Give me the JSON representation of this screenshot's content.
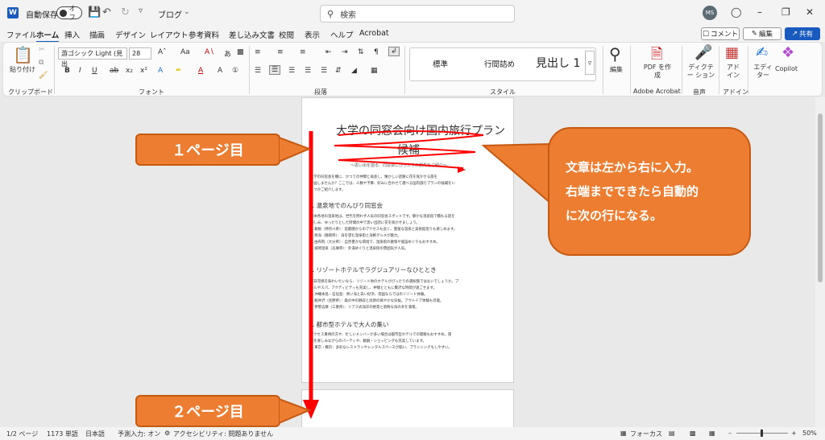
{
  "titlebar": {
    "app_icon": "W",
    "autosave_label": "自動保存",
    "autosave_state": "オフ",
    "doc_name": "ブログ",
    "search_placeholder": "検索",
    "user_initials": "MS"
  },
  "menu": [
    "ファイル",
    "ホーム",
    "挿入",
    "描画",
    "デザイン",
    "レイアウト",
    "参考資料",
    "差し込み文書",
    "校閲",
    "表示",
    "ヘルプ",
    "Acrobat"
  ],
  "menu_active": "ホーム",
  "actions": {
    "comment": "コメント",
    "edit": "編集",
    "share": "共有"
  },
  "ribbon": {
    "paste": "貼り付け",
    "font_name": "游ゴシック Light (見出",
    "font_size": "28",
    "styles": [
      "標準",
      "行間詰め",
      "見出し 1"
    ],
    "groups": [
      "クリップボード",
      "フォント",
      "段落",
      "スタイル",
      "Adobe Acrobat",
      "音声",
      "アドイン"
    ],
    "edit": "編集",
    "pdf": "PDF を作成",
    "dictate": "ディクテー ション",
    "addin": "アド イン",
    "editor": "エディ ター",
    "copilot": "Copilot"
  },
  "document": {
    "title": "大学の同窓会向け国内旅行プラン",
    "title2": "候補",
    "subtitle": "～思い出を語る、同窓会にぴったりの旅先をご紹介～",
    "intro": [
      "大学の同窓会を機に、かつての仲間と再会し、懐かしい話題に花を咲かせる旅を",
      "計画しませんか？ここでは、人数や予算、好みに合わせて選べる国内旅行プランの候補をい",
      "くつかご紹介します。"
    ],
    "section1": "1. 温泉地でのんびり同窓会",
    "section1_body": [
      "日本各地の温泉地は、世代を問わず人気の同窓会スポットです。静かな温泉宿で積もる話を",
      "楽しみ、ゆったりとした時間の中で思い出話に花を咲かせましょう。",
      "● 箱根（神奈川県）：首都圏からのアクセスも良く、豊富な温泉と美術館巡りも楽しめます。",
      "● 熱海（静岡県）：海を望む温泉街と海鮮グルメが魅力。",
      "● 由布院（大分県）：自然豊かな環境で、温泉街の散策や施設めぐりもおすすめ。",
      "● 城崎温泉（兵庫県）：外湯めぐりと温泉街の雰囲気が人気。"
    ],
    "section2": "2. リゾートホテルでラグジュアリーなひととき",
    "section2_body": [
      "非日常感を味わいたいなら、リゾート地のホテルがぴったりの選択肢ではないでしょうか。プ",
      "ールやスパ、アクティビティも充実し、仲間とともに贅沢な時間が過ごせます。",
      "● 沖縄本島・石垣島：青い海と白い砂浜、南国ならではのリゾート体験。",
      "● 軽井沢（長野県）：森の中の静寂と高原の爽やかな気候。アウトドア体験も可能。",
      "● 伊勢志摩（三重県）：リアス式海岸の絶景と新鮮な海の幸を満喫。"
    ],
    "section3": "3. 都市型ホテルで大人の集い",
    "section3_body": [
      "アクセス重視の方や、忙しいメンバーが多い場合は都市型ホテルでの開催もおすすめ。夜",
      "景を楽しみながらのパーティや、観劇・ショッピングも充実しています。",
      "● 東京・横浜：多彩なレストランやレンタルスペースが揃い、プランニングもしやすい。"
    ]
  },
  "annotations": {
    "page1": "１ページ目",
    "page2": "２ページ目",
    "note": [
      "文章は左から右に入力。",
      "右端までできたら自動的",
      "に次の行になる。"
    ],
    "arrow_color": "#ff0000",
    "callout_color": "#ed7d31"
  },
  "status": {
    "page": "1/2 ページ",
    "words": "1173 単語",
    "lang": "日本語",
    "predict": "予測入力: オン",
    "access": "アクセシビリティ: 問題ありません",
    "focus": "フォーカス",
    "zoom": "50%"
  }
}
